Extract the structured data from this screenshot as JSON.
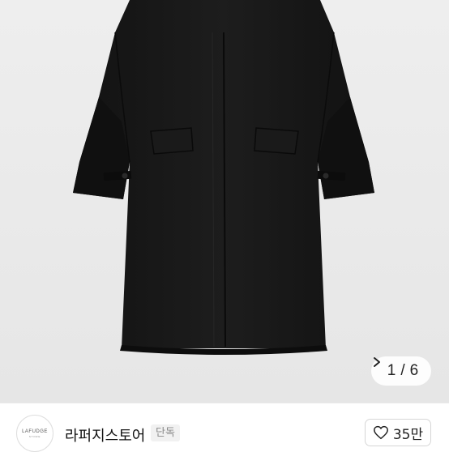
{
  "product_image": {
    "alt": "black wool long coat",
    "counter": {
      "current": "1",
      "separator": "/",
      "total": "6"
    },
    "next_icon": "chevron-right-icon"
  },
  "store": {
    "logo_text": "LAFUDGE",
    "logo_subtext": "STORE",
    "name": "라퍼지스토어",
    "badge": "단독"
  },
  "like": {
    "icon": "heart-outline-icon",
    "count": "35만"
  },
  "colors": {
    "coat": "#161616",
    "background": "#ececec",
    "text": "#111111",
    "badge_bg": "#f1f1f1",
    "badge_text": "#8a8a8a"
  }
}
